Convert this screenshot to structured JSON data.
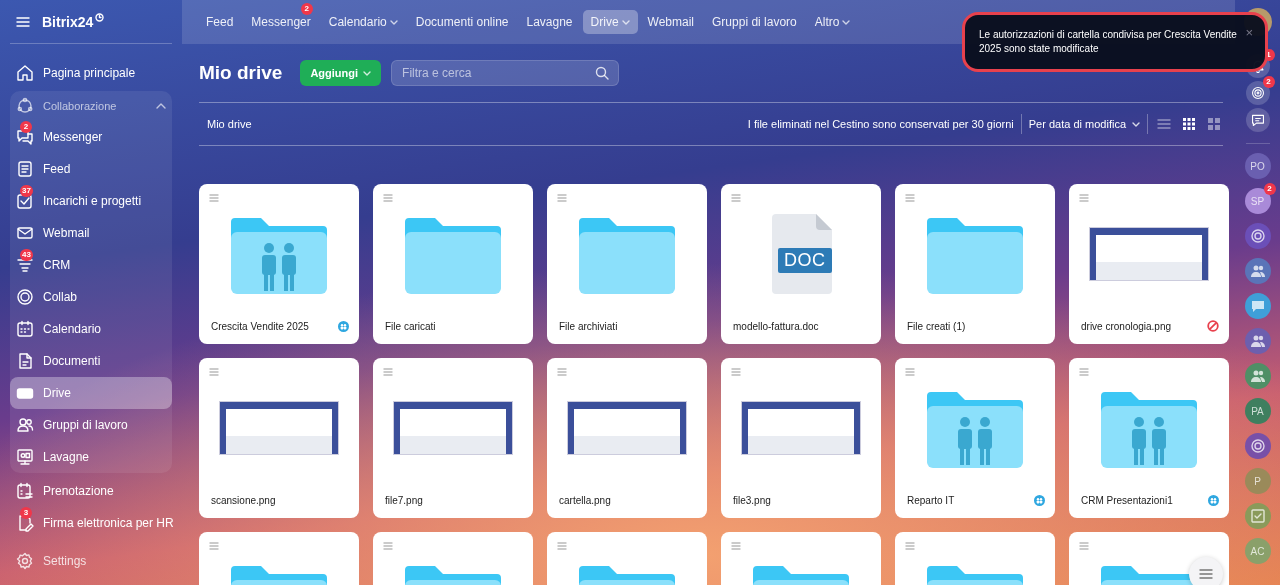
{
  "sidebar": {
    "logo": "Bitrix24",
    "items_top": [
      {
        "label": "Pagina principale",
        "selected": false
      }
    ],
    "group": {
      "label": "Collaborazione",
      "expanded": true,
      "children": [
        {
          "label": "Messenger",
          "badge": "2",
          "selected": false
        },
        {
          "label": "Feed",
          "selected": false
        },
        {
          "label": "Incarichi e progetti",
          "badge": "37",
          "selected": false
        },
        {
          "label": "Webmail",
          "selected": false
        },
        {
          "label": "CRM",
          "badge": "43",
          "selected": false
        },
        {
          "label": "Collab",
          "selected": false
        },
        {
          "label": "Calendario",
          "selected": false
        },
        {
          "label": "Documenti",
          "selected": false
        },
        {
          "label": "Drive",
          "selected": true
        },
        {
          "label": "Gruppi di lavoro",
          "selected": false
        },
        {
          "label": "Lavagne",
          "selected": false
        }
      ]
    },
    "items_bottom": [
      {
        "label": "Prenotazione",
        "selected": false
      },
      {
        "label": "Firma elettronica per HR",
        "badge": "3",
        "selected": false
      }
    ],
    "settings": "Settings"
  },
  "nav": [
    {
      "label": "Feed",
      "dropdown": false,
      "selected": false
    },
    {
      "label": "Messenger",
      "badge": "2",
      "dropdown": false,
      "selected": false
    },
    {
      "label": "Calendario",
      "dropdown": true,
      "selected": false
    },
    {
      "label": "Documenti online",
      "dropdown": false,
      "selected": false
    },
    {
      "label": "Lavagne",
      "dropdown": false,
      "selected": false
    },
    {
      "label": "Drive",
      "dropdown": true,
      "selected": true
    },
    {
      "label": "Webmail",
      "dropdown": false,
      "selected": false
    },
    {
      "label": "Gruppi di lavoro",
      "dropdown": false,
      "selected": false
    },
    {
      "label": "Altro",
      "dropdown": true,
      "selected": false
    }
  ],
  "notification": {
    "text": "Le autorizzazioni di cartella condivisa per Crescita Vendite 2025 sono state modificate",
    "close": "×"
  },
  "page": {
    "title": "Mio drive",
    "add_button": "Aggiungi",
    "search": {
      "placeholder": "Filtra e cerca"
    }
  },
  "toolbar": {
    "breadcrumb": "Mio drive",
    "retention_note": "I file eliminati nel Cestino sono conservati per 30 giorni",
    "sort": "Per data di modifica",
    "views": [
      {
        "kind": "list",
        "selected": false
      },
      {
        "kind": "grid",
        "selected": true
      },
      {
        "kind": "tiles",
        "selected": false
      }
    ]
  },
  "files": [
    {
      "kind": "shared-folder",
      "name": "Crescita Vendite 2025",
      "shared": true,
      "access_denied": false
    },
    {
      "kind": "folder",
      "name": "File caricati",
      "shared": false,
      "access_denied": false
    },
    {
      "kind": "folder",
      "name": "File archiviati",
      "shared": false,
      "access_denied": false
    },
    {
      "kind": "doc",
      "name": "modello-fattura.doc",
      "label": "DOC",
      "shared": false,
      "access_denied": false
    },
    {
      "kind": "folder",
      "name": "File creati (1)",
      "shared": false,
      "access_denied": false
    },
    {
      "kind": "image",
      "name": "drive cronologia.png",
      "shared": false,
      "access_denied": true
    },
    {
      "kind": "image",
      "name": "scansione.png",
      "shared": false,
      "access_denied": false
    },
    {
      "kind": "image",
      "name": "file7.png",
      "shared": false,
      "access_denied": false
    },
    {
      "kind": "image",
      "name": "cartella.png",
      "shared": false,
      "access_denied": false
    },
    {
      "kind": "image",
      "name": "file3.png",
      "shared": false,
      "access_denied": false
    },
    {
      "kind": "shared-folder",
      "name": "Reparto IT",
      "shared": true,
      "access_denied": false
    },
    {
      "kind": "shared-folder",
      "name": "CRM Presentazioni1",
      "shared": true,
      "access_denied": false
    },
    {
      "kind": "folder"
    },
    {
      "kind": "folder"
    },
    {
      "kind": "folder"
    },
    {
      "kind": "folder"
    },
    {
      "kind": "folder"
    },
    {
      "kind": "folder"
    }
  ],
  "rail": {
    "tools": [
      {
        "kind": "bell",
        "badge": "1"
      },
      {
        "kind": "copilot",
        "badge": "2"
      },
      {
        "kind": "chat"
      }
    ],
    "contacts": [
      {
        "kind": "initials",
        "initials": "PO",
        "color": "#6a5fb0"
      },
      {
        "kind": "initials",
        "initials": "SP",
        "color": "#a98ad8",
        "badge": "2"
      },
      {
        "kind": "spiral",
        "color": "#6b4fb8"
      },
      {
        "kind": "group",
        "color": "#5a74b8"
      },
      {
        "kind": "chat",
        "color": "#3f9fd8"
      },
      {
        "kind": "group",
        "color": "#6d5fae"
      },
      {
        "kind": "group",
        "color": "#4f8f66"
      },
      {
        "kind": "initials",
        "initials": "PA",
        "color": "#3f7f5f"
      },
      {
        "kind": "spiral",
        "color": "#7850a8"
      },
      {
        "kind": "initials",
        "initials": "P",
        "color": "#9a8a5a"
      },
      {
        "kind": "task",
        "color": "#8a9a5a"
      },
      {
        "kind": "initials",
        "initials": "AC",
        "color": "#8aa06a"
      }
    ]
  }
}
